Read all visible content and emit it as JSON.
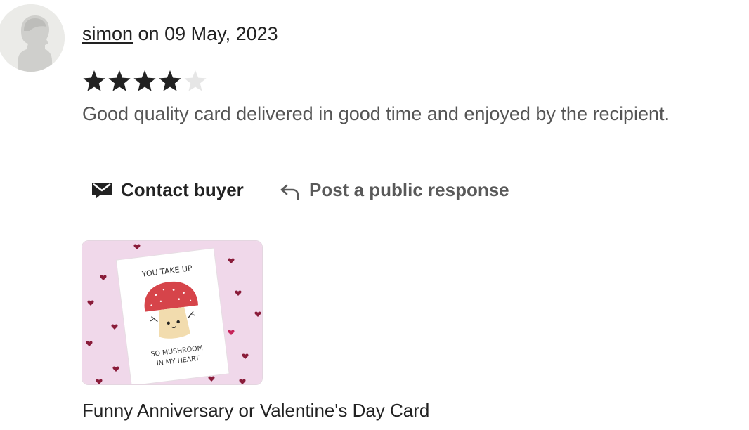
{
  "review": {
    "reviewer_name": "simon",
    "date_text": " on 09 May, 2023",
    "rating": 4,
    "rating_max": 5,
    "text": "Good quality card delivered in good time and enjoyed by the recipient."
  },
  "actions": {
    "contact_label": "Contact buyer",
    "public_response_label": "Post a public response"
  },
  "product": {
    "title": "Funny Anniversary or Valentine's Day Card",
    "card_text_top": "YOU TAKE UP",
    "card_text_bottom_1": "SO MUSHROOM",
    "card_text_bottom_2": "IN MY HEART"
  },
  "colors": {
    "star_filled": "#222222",
    "star_empty": "#e6e6e6",
    "thumbnail_bg": "#f0d8ea",
    "mushroom_cap": "#d6444a"
  },
  "icons": {
    "avatar": "default-user-silhouette",
    "contact": "envelope-icon",
    "public_response": "reply-arrow-icon"
  }
}
